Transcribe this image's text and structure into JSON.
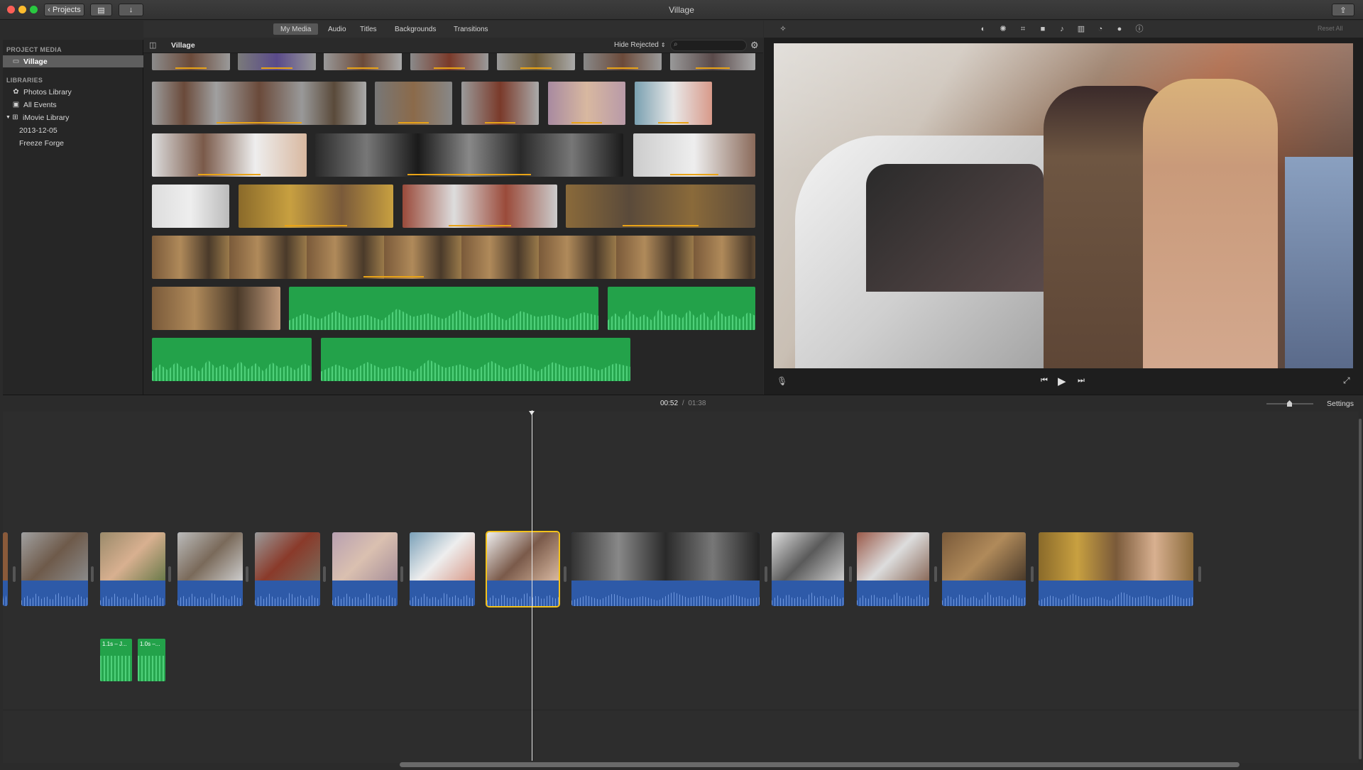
{
  "window": {
    "title": "Village"
  },
  "toolbar": {
    "projects_label": "Projects"
  },
  "sidebar": {
    "project_media_heading": "PROJECT MEDIA",
    "project_item": "Village",
    "libraries_heading": "LIBRARIES",
    "libraries": [
      "Photos Library",
      "All Events",
      "iMovie Library",
      "2013-12-05",
      "Freeze Forge"
    ]
  },
  "tabs": [
    "My Media",
    "Audio",
    "Titles",
    "Backgrounds",
    "Transitions"
  ],
  "active_tab": "My Media",
  "browser": {
    "title": "Village",
    "filter": "Hide Rejected",
    "search_placeholder": ""
  },
  "viewer": {
    "reset_label": "Reset All"
  },
  "timeline": {
    "current_time": "00:52",
    "separator": "/",
    "total_time": "01:38",
    "settings_label": "Settings",
    "audio_clips": [
      "1.1s – J...",
      "1.0s –..."
    ]
  },
  "colors": {
    "accent": "#f3c21b",
    "audio_green": "#23a24a",
    "timeline_audio": "#2e5aa8",
    "rating_bar": "#e8a317"
  }
}
